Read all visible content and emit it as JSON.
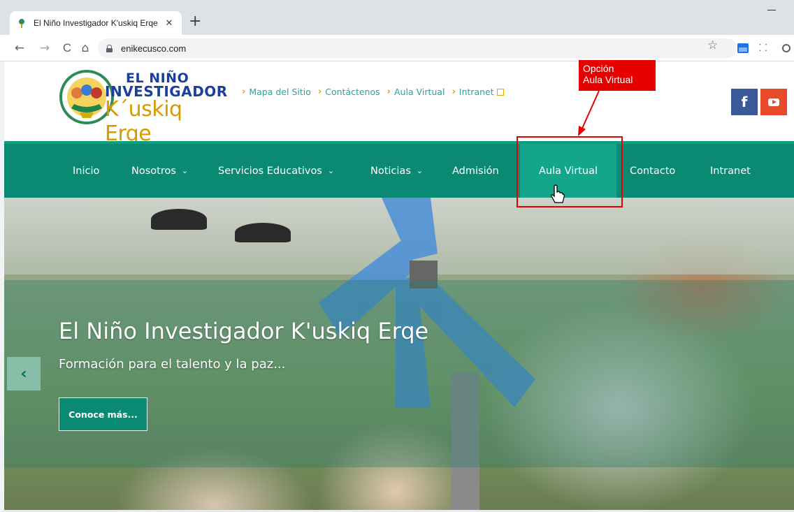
{
  "browser": {
    "tab_title": "El Niño Investigador K'uskiq Erqe",
    "tab_close": "✕",
    "new_tab": "+",
    "back": "←",
    "forward": "→",
    "reload": "C",
    "home": "⌂",
    "url": "enikecusco.com",
    "bookmark": "☆",
    "ext_icon2": "⸬"
  },
  "logo": {
    "line1": "EL NIÑO",
    "line2": "INVESTIGADOR",
    "line3": "K´uskiq Erqe"
  },
  "toplinks": [
    {
      "label": "Mapa del Sitio"
    },
    {
      "label": "Contáctenos"
    },
    {
      "label": "Aula Virtual"
    },
    {
      "label": "Intranet"
    }
  ],
  "social": {
    "facebook": "f"
  },
  "nav": {
    "items": [
      {
        "label": "Inicio"
      },
      {
        "label": "Nosotros",
        "caret": "⌄"
      },
      {
        "label": "Servicios Educativos",
        "caret": "⌄"
      },
      {
        "label": "Noticias",
        "caret": "⌄"
      },
      {
        "label": "Admisión"
      },
      {
        "label": "Aula Virtual"
      },
      {
        "label": "Contacto"
      },
      {
        "label": "Intranet"
      }
    ]
  },
  "annotation": {
    "line1": "Opción",
    "line2": "Aula Virtual"
  },
  "hero": {
    "title": "El Niño Investigador K'uskiq Erqe",
    "subtitle": "Formación para el talento y la paz...",
    "button": "Conoce más...",
    "prev": "‹"
  },
  "colors": {
    "brand_green": "#0a8a73",
    "active_green": "#13a68a",
    "accent_orange": "#e6a400",
    "annotation_red": "#e60000"
  }
}
